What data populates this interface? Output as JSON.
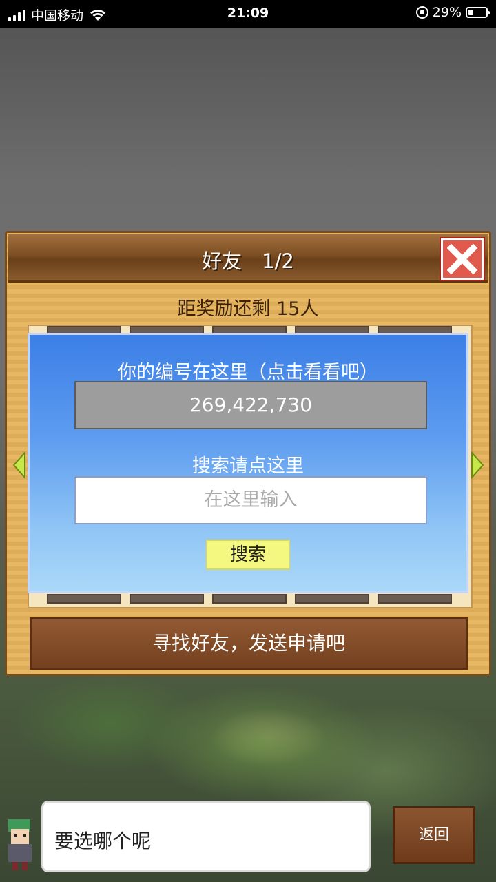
{
  "status_bar": {
    "carrier": "中国移动",
    "time": "21:09",
    "battery": "29%",
    "battery_level": 0.29
  },
  "dialog": {
    "title": "好友　1/2",
    "close_icon": "close-x-icon",
    "reward_text": "距奖励还剩 15人",
    "id_label": "你的编号在这里（点击看看吧）",
    "player_id": "269,422,730",
    "search_label": "搜索请点这里",
    "search_placeholder": "在这里输入",
    "search_button": "搜索",
    "find_friends_button": "寻找好友，发送申请吧"
  },
  "bottom": {
    "speech_text": "要选哪个呢",
    "back_button": "返回"
  },
  "colors": {
    "header_brown": "#7c4e22",
    "panel_blue": "#3c7fe6",
    "close_red": "#e05a4e",
    "search_yellow": "#f4f780"
  }
}
